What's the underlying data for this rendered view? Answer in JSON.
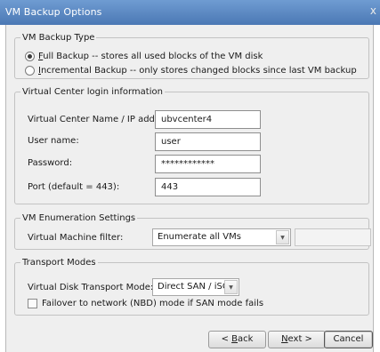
{
  "window": {
    "title": "VM Backup Options",
    "close_label": "x"
  },
  "backup_type": {
    "legend": "VM Backup Type",
    "options": [
      {
        "accel": "F",
        "rest": "ull Backup -- stores all used blocks of the VM disk",
        "checked": true
      },
      {
        "accel": "I",
        "rest": "ncremental Backup -- only stores changed blocks since last VM backup",
        "checked": false
      }
    ]
  },
  "vcenter": {
    "legend": "Virtual Center login information",
    "name_label": "Virtual Center Name / IP address:",
    "name_value": "ubvcenter4",
    "user_label": "User name:",
    "user_value": "user",
    "password_label": "Password:",
    "password_value": "************",
    "port_label": "Port (default = 443):",
    "port_value": "443"
  },
  "enumeration": {
    "legend": "VM Enumeration Settings",
    "filter_label": "Virtual Machine filter:",
    "filter_value": "Enumerate all VMs"
  },
  "transport": {
    "legend": "Transport Modes",
    "mode_label": "Virtual Disk Transport Mode:",
    "mode_value": "Direct SAN / iSCSI",
    "failover_label": "Failover to network (NBD) mode if SAN mode fails",
    "failover_checked": false
  },
  "buttons": {
    "back_pre": "< ",
    "back_accel": "B",
    "back_rest": "ack",
    "next_accel": "N",
    "next_rest": "ext >",
    "cancel": "Cancel"
  }
}
